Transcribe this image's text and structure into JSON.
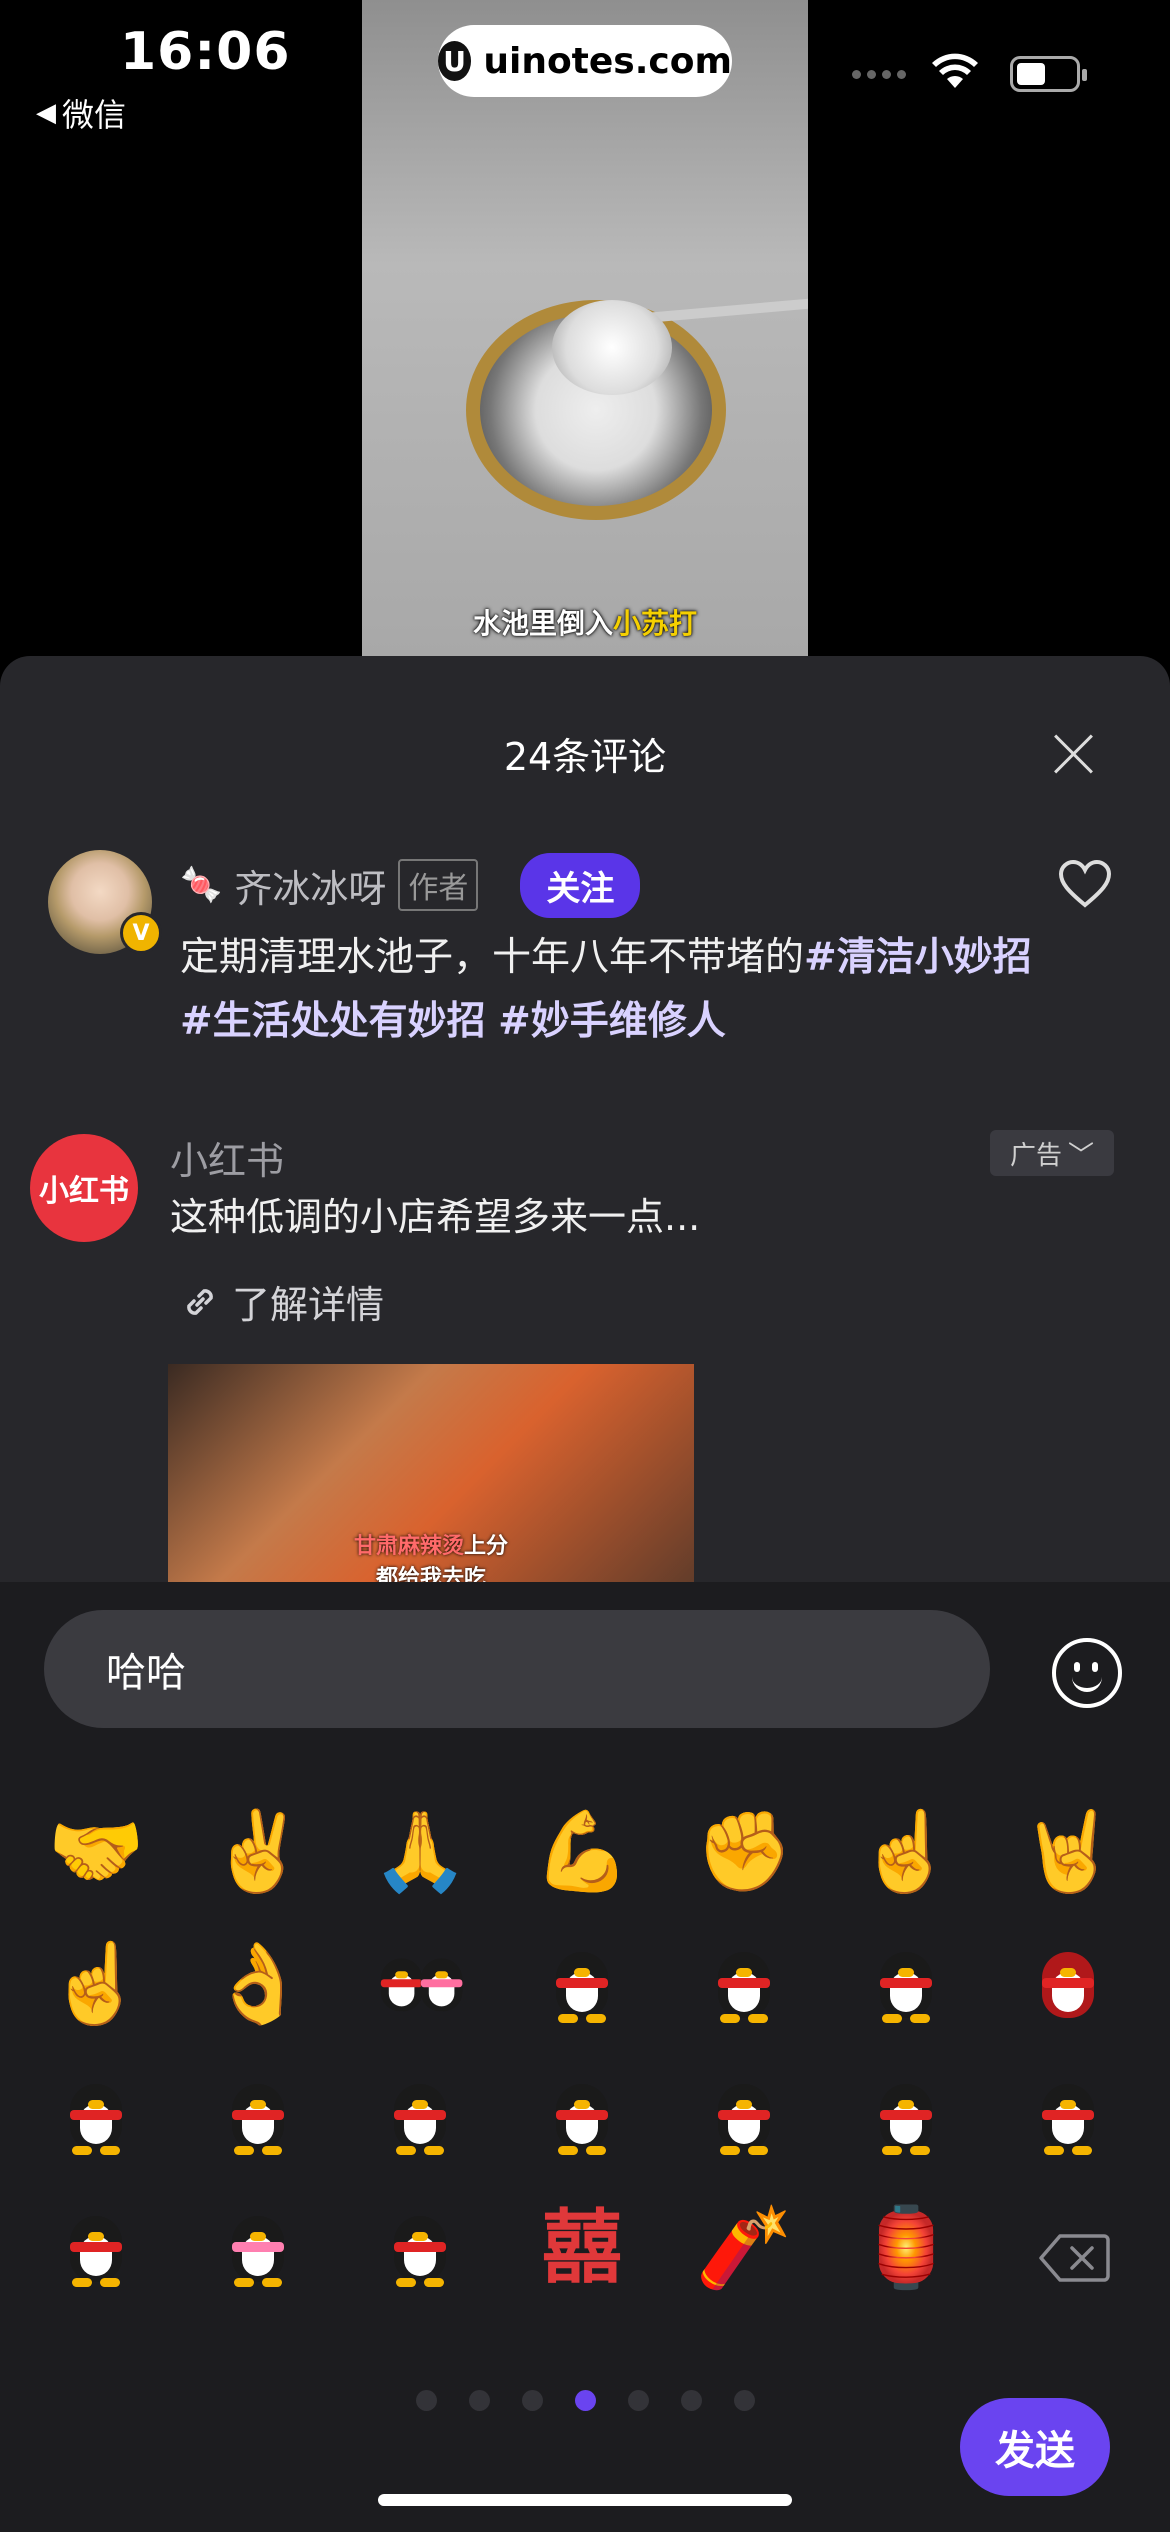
{
  "status_bar": {
    "time": "16:06",
    "back_app": "微信",
    "url": "uinotes.com",
    "url_logo": "U"
  },
  "video": {
    "caption_prefix": "水池里倒入",
    "caption_highlight": "小苏打"
  },
  "comments": {
    "title": "24条评论",
    "author": {
      "name": "齐冰冰呀",
      "tag": "作者",
      "follow_label": "关注",
      "verified": "V",
      "text": "定期清理水池子，十年八年不带堵的",
      "hashtags": [
        "#清洁小妙招",
        "#生活处处有妙招",
        "#妙手维修人"
      ]
    },
    "ad": {
      "logo_text": "小红书",
      "name": "小红书",
      "badge": "广告",
      "text": "这种低调的小店希望多来一点...",
      "link_label": "了解详情",
      "image_caption_red": "甘肃麻辣烫",
      "image_caption_rest": "上分",
      "image_caption_line2": "都给我去吃"
    }
  },
  "input": {
    "value": "哈哈",
    "send_label": "发送"
  },
  "emoji_panel": {
    "row1": [
      "🤝",
      "✌️",
      "🙏",
      "💪",
      "✊",
      "☝️",
      "🤘"
    ],
    "row2": [
      "☝️",
      "👌"
    ],
    "row4_items": [
      "囍",
      "🧨",
      "🏮"
    ],
    "page_dots": 7,
    "active_dot": 4
  },
  "colors": {
    "accent": "#6a44f0",
    "follow": "#5a35e8",
    "sheet": "#27272b",
    "ad_logo": "#e8343e"
  }
}
